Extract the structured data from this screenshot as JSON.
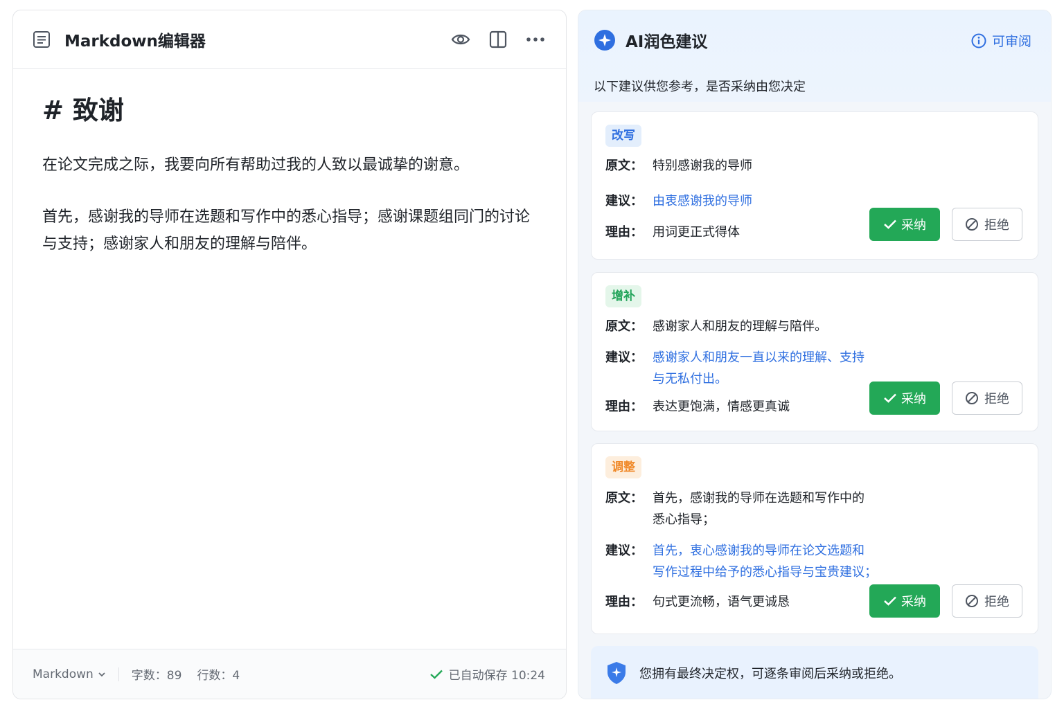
{
  "editor": {
    "title": "Markdown编辑器",
    "heading": "# 致谢",
    "paragraph1": "在论文完成之际，我要向所有帮助过我的人致以最诚挚的谢意。",
    "paragraph2": "首先，感谢我的导师在选题和写作中的悉心指导；感谢课题组同门的讨论与支持；感谢家人和朋友的理解与陪伴。",
    "footer": {
      "mode": "Markdown",
      "word_count": "字数：89",
      "line_count": "行数：4",
      "save_status": "已自动保存 10:24"
    },
    "icons": [
      "doc-icon",
      "eye-icon",
      "split-view-icon",
      "more-icon",
      "chevron-down-icon",
      "check-icon"
    ]
  },
  "ai_panel": {
    "title": "AI润色建议",
    "review_link": "可审阅",
    "subtitle": "以下建议供您参考，是否采纳由您决定",
    "labels": {
      "original": "原文：",
      "suggestion": "建议：",
      "reason": "理由："
    },
    "accept_label": "采纳",
    "reject_label": "拒绝",
    "suggestions": [
      {
        "tag": "改写",
        "original": "特别感谢我的导师",
        "suggestion": "由衷感谢我的导师",
        "reason": "用词更正式得体"
      },
      {
        "tag": "增补",
        "original": "感谢家人和朋友的理解与陪伴。",
        "suggestion_line1": "感谢家人和朋友一直以来的理解、支持",
        "suggestion_line2": "与无私付出。",
        "reason": "表达更饱满，情感更真诚"
      },
      {
        "tag": "调整",
        "original_line1": "首先，感谢我的导师在选题和写作中的",
        "original_line2": "悉心指导；",
        "suggestion_line1": "首先，衷心感谢我的导师在论文选题和",
        "suggestion_line2": "写作过程中给予的悉心指导与宝贵建议；",
        "reason": "句式更流畅，语气更诚恳"
      }
    ],
    "notice": "您拥有最终决定权，可逐条审阅后采纳或拒绝。",
    "colors": {
      "accent_blue": "#2f6fe0",
      "accept_green": "#23a857",
      "tag_green": "#22a45a",
      "tag_orange": "#f08a2a"
    }
  }
}
